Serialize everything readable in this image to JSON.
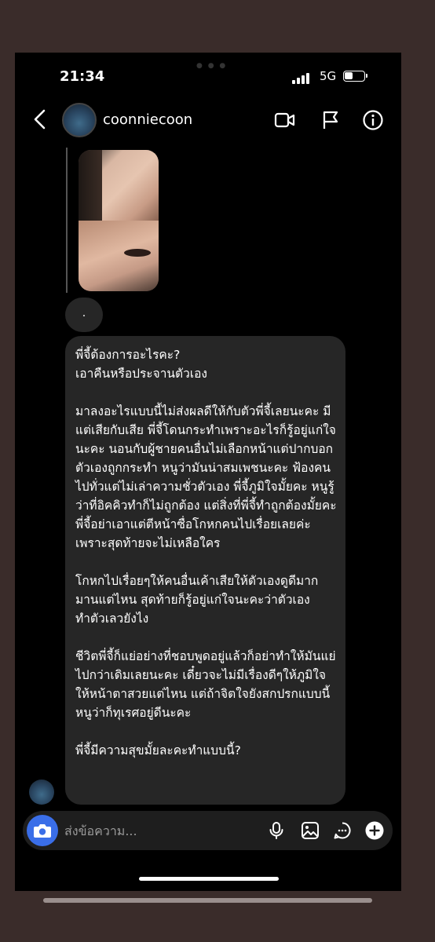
{
  "status": {
    "time": "21:34",
    "network": "5G"
  },
  "header": {
    "username": "coonniecoon",
    "back_icon": "chevron-left-icon",
    "video_icon": "video-camera-icon",
    "flag_icon": "flag-icon",
    "info_icon": "info-icon"
  },
  "thread": {
    "dot_message": ".",
    "message_paragraphs": [
      "พี่จี้ต้องการอะไรคะ?\nเอาคืนหรือประจานตัวเอง",
      "มาลงอะไรแบบนี้ไม่ส่งผลดีให้กับตัวพี่จี้เลยนะคะ มีแต่เสียกับเสีย พี่จี้โดนกระทำเพราะอะไรก็รู้อยู่แก่ใจนะคะ นอนกับผู้ชายคนอื่นไม่เลือกหน้าแต่ปากบอกตัวเองถูกกระทำ หนูว่ามันน่าสมเพชนะคะ ฟ้องคนไปทั่วแต่ไม่เล่าความชั่วตัวเอง พี่จี้ภูมิใจมั้ยคะ หนูรู้ว่าที่อิคคิวทำก็ไม่ถูกต้อง แต่สิ่งที่พี่จี้ทำถูกต้องมั้ยคะ พี่จี้อย่าเอาแต่ตีหน้าซื่อโกหกคนไปเรื่อยเลยค่ะ เพราะสุดท้ายจะไม่เหลือใคร",
      "โกหกไปเรื่อยๆให้คนอื่นเค้าเสียให้ตัวเองดูดีมากมานแต่ไหน สุดท้ายก็รู้อยู่แก่ใจนะคะว่าตัวเองทำตัวเลวยังไง",
      "ชีวิตพี่จี้ก็แย่อย่างที่ชอบพูดอยู่แล้วก็อย่าทำให้มันแย่ไปกว่าเดิมเลยนะคะ เดี๋ยวจะไม่มีเรื่องดีๆให้ภูมิใจ ให้หน้าตาสวยแต่ไหน แต่ถ้าจิตใจยังสกปรกแบบนี้หนูว่าก็ทุเรศอยู่ดีนะคะ",
      "พี่จี้มีความสุขมั้ยละคะทำแบบนี้?"
    ]
  },
  "composer": {
    "placeholder": "ส่งข้อความ...",
    "camera_icon": "camera-icon",
    "mic_icon": "microphone-icon",
    "gallery_icon": "image-icon",
    "sticker_icon": "chat-sticker-icon",
    "plus_icon": "plus-circle-icon",
    "camera_color": "#3a6ee8"
  }
}
